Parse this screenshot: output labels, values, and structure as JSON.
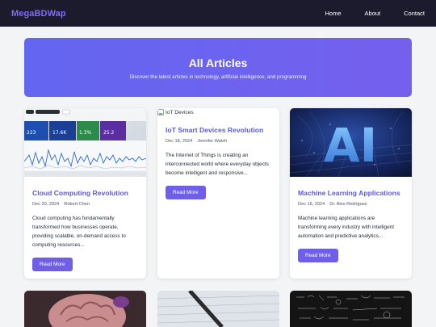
{
  "nav": {
    "brand": "MegaBDWap",
    "links": [
      "Home",
      "About",
      "Contact"
    ]
  },
  "hero": {
    "title": "All Articles",
    "subtitle": "Discover the latest articles in technology, artificial intelligence, and programming"
  },
  "articles": [
    {
      "title": "Cloud Computing Revolution",
      "date": "Dec 20, 2024",
      "author": "Robert Chen",
      "excerpt": "Cloud computing has fundamentally transformed how businesses operate, providing scalable, on-demand access to computing resources...",
      "button": "Read More",
      "image": "dashboard-analytics-photo",
      "dashboard_tiles": [
        "223",
        "17.6K",
        "1.3%",
        "25.2"
      ]
    },
    {
      "title": "IoT Smart Devices Revolution",
      "date": "Dec 18, 2024",
      "author": "Jennifer Walsh",
      "excerpt": "The Internet of Things is creating an interconnected world where everyday objects become intelligent and responsive...",
      "button": "Read More",
      "image_alt": "IoT Devices"
    },
    {
      "title": "Machine Learning Applications",
      "date": "Dec 16, 2024",
      "author": "Dr. Alex Rodriguez",
      "excerpt": "Machine learning applications are transforming every industry with intelligent automation and predictive analytics...",
      "button": "Read More",
      "image": "ai-3d-letters-photo",
      "image_text": "AI"
    }
  ],
  "next_row_images": [
    "brain-model-photo",
    "pen-on-paper-photo",
    "chalkboard-formulas-photo"
  ],
  "colors": {
    "navbar": "#1c1b2e",
    "brand": "#7c6cf6",
    "hero_start": "#6366f1",
    "hero_end": "#7560ee",
    "title": "#5b5bd6",
    "button": "#6f5fe8"
  }
}
